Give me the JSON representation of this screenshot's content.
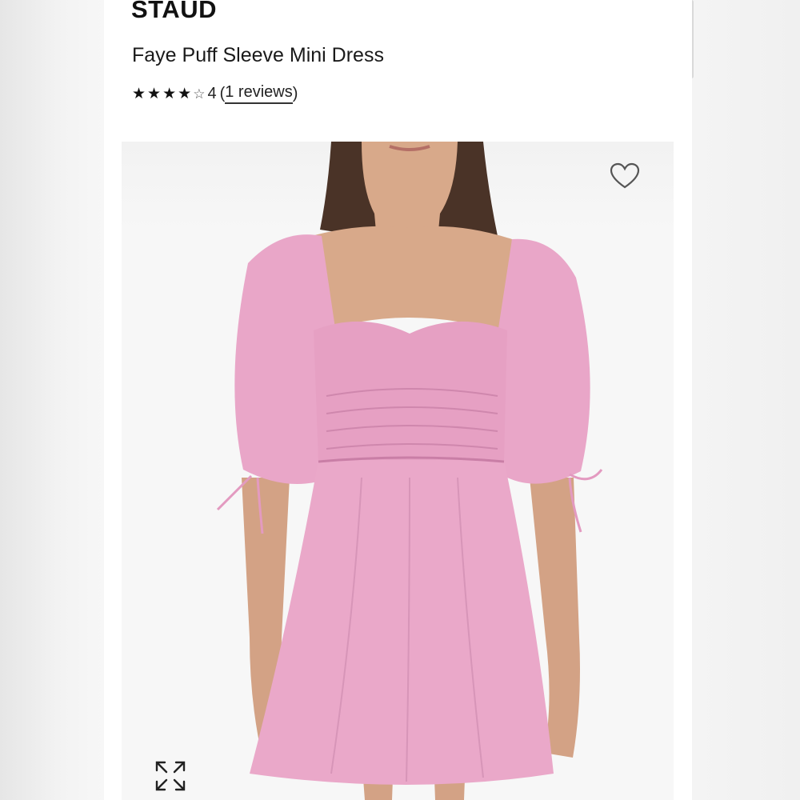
{
  "product": {
    "brand": "STAUD",
    "title": "Faye Puff Sleeve Mini Dress",
    "rating": {
      "stars_filled": 4,
      "value": "4",
      "reviews_open": "(",
      "reviews_label": "1 reviews",
      "reviews_close": ")"
    }
  },
  "image": {
    "icons": [
      "heart-icon",
      "expand-icon"
    ],
    "colors": {
      "dress": "#e9a6c8",
      "skin": "#d8a98a",
      "hair": "#4a3327"
    }
  }
}
